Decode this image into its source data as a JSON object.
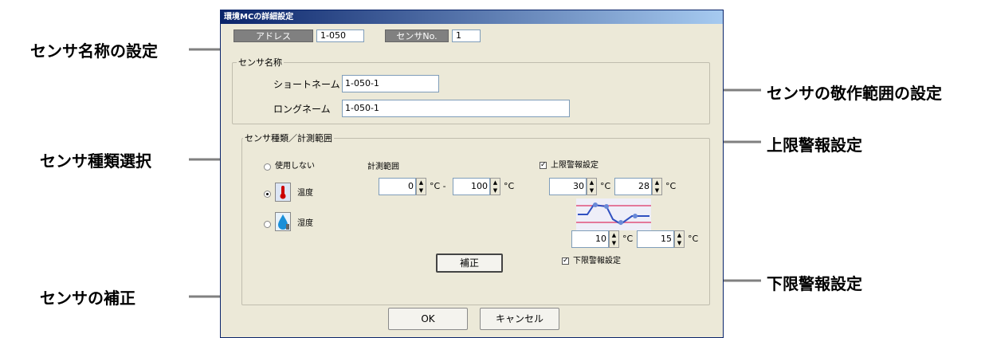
{
  "callouts": {
    "sensor_name": "センサ名称の設定",
    "range": "センサの敬作範囲の設定",
    "upper": "上限警報設定",
    "type": "センサ種類選択",
    "lower": "下限警報設定",
    "correction": "センサの補正"
  },
  "dialog": {
    "title": "環境MCの詳細設定",
    "address_label": "アドレス",
    "address_value": "1-050",
    "sensor_no_label": "センサNo.",
    "sensor_no_value": "1"
  },
  "name_group": {
    "legend": "センサ名称",
    "short_label": "ショートネーム",
    "short_value": "1-050-1",
    "long_label": "ロングネーム",
    "long_value": "1-050-1"
  },
  "type_group": {
    "legend": "センサ種類／計測範囲",
    "options": [
      {
        "label": "使用しない",
        "selected": false
      },
      {
        "label": "温度",
        "selected": true
      },
      {
        "label": "湿度",
        "selected": false
      }
    ],
    "range_label": "計測範囲",
    "range_min": "0",
    "range_min_unit": "°C -",
    "range_max": "100",
    "range_max_unit": "°C",
    "upper_label": "上限警報設定",
    "upper_checked": true,
    "upper_1": "30",
    "upper_2": "28",
    "lower_1": "10",
    "lower_2": "15",
    "unit": "°C",
    "lower_label": "下限警報設定",
    "lower_checked": true,
    "correction_button": "補正"
  },
  "buttons": {
    "ok": "OK",
    "cancel": "キャンセル"
  },
  "icons": {
    "spin_up": "▲",
    "spin_down": "▼",
    "check_mark": "✓"
  }
}
